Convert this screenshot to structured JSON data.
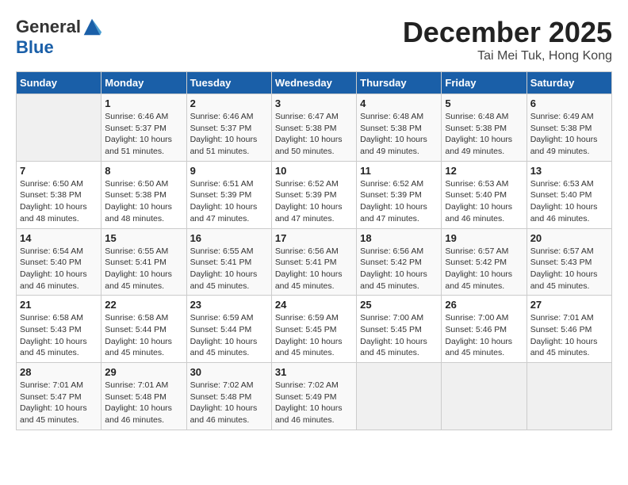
{
  "header": {
    "logo_line1": "General",
    "logo_line2": "Blue",
    "month_title": "December 2025",
    "location": "Tai Mei Tuk, Hong Kong"
  },
  "weekdays": [
    "Sunday",
    "Monday",
    "Tuesday",
    "Wednesday",
    "Thursday",
    "Friday",
    "Saturday"
  ],
  "weeks": [
    [
      {
        "day": "",
        "info": ""
      },
      {
        "day": "1",
        "info": "Sunrise: 6:46 AM\nSunset: 5:37 PM\nDaylight: 10 hours\nand 51 minutes."
      },
      {
        "day": "2",
        "info": "Sunrise: 6:46 AM\nSunset: 5:37 PM\nDaylight: 10 hours\nand 51 minutes."
      },
      {
        "day": "3",
        "info": "Sunrise: 6:47 AM\nSunset: 5:38 PM\nDaylight: 10 hours\nand 50 minutes."
      },
      {
        "day": "4",
        "info": "Sunrise: 6:48 AM\nSunset: 5:38 PM\nDaylight: 10 hours\nand 49 minutes."
      },
      {
        "day": "5",
        "info": "Sunrise: 6:48 AM\nSunset: 5:38 PM\nDaylight: 10 hours\nand 49 minutes."
      },
      {
        "day": "6",
        "info": "Sunrise: 6:49 AM\nSunset: 5:38 PM\nDaylight: 10 hours\nand 49 minutes."
      }
    ],
    [
      {
        "day": "7",
        "info": "Sunrise: 6:50 AM\nSunset: 5:38 PM\nDaylight: 10 hours\nand 48 minutes."
      },
      {
        "day": "8",
        "info": "Sunrise: 6:50 AM\nSunset: 5:38 PM\nDaylight: 10 hours\nand 48 minutes."
      },
      {
        "day": "9",
        "info": "Sunrise: 6:51 AM\nSunset: 5:39 PM\nDaylight: 10 hours\nand 47 minutes."
      },
      {
        "day": "10",
        "info": "Sunrise: 6:52 AM\nSunset: 5:39 PM\nDaylight: 10 hours\nand 47 minutes."
      },
      {
        "day": "11",
        "info": "Sunrise: 6:52 AM\nSunset: 5:39 PM\nDaylight: 10 hours\nand 47 minutes."
      },
      {
        "day": "12",
        "info": "Sunrise: 6:53 AM\nSunset: 5:40 PM\nDaylight: 10 hours\nand 46 minutes."
      },
      {
        "day": "13",
        "info": "Sunrise: 6:53 AM\nSunset: 5:40 PM\nDaylight: 10 hours\nand 46 minutes."
      }
    ],
    [
      {
        "day": "14",
        "info": "Sunrise: 6:54 AM\nSunset: 5:40 PM\nDaylight: 10 hours\nand 46 minutes."
      },
      {
        "day": "15",
        "info": "Sunrise: 6:55 AM\nSunset: 5:41 PM\nDaylight: 10 hours\nand 45 minutes."
      },
      {
        "day": "16",
        "info": "Sunrise: 6:55 AM\nSunset: 5:41 PM\nDaylight: 10 hours\nand 45 minutes."
      },
      {
        "day": "17",
        "info": "Sunrise: 6:56 AM\nSunset: 5:41 PM\nDaylight: 10 hours\nand 45 minutes."
      },
      {
        "day": "18",
        "info": "Sunrise: 6:56 AM\nSunset: 5:42 PM\nDaylight: 10 hours\nand 45 minutes."
      },
      {
        "day": "19",
        "info": "Sunrise: 6:57 AM\nSunset: 5:42 PM\nDaylight: 10 hours\nand 45 minutes."
      },
      {
        "day": "20",
        "info": "Sunrise: 6:57 AM\nSunset: 5:43 PM\nDaylight: 10 hours\nand 45 minutes."
      }
    ],
    [
      {
        "day": "21",
        "info": "Sunrise: 6:58 AM\nSunset: 5:43 PM\nDaylight: 10 hours\nand 45 minutes."
      },
      {
        "day": "22",
        "info": "Sunrise: 6:58 AM\nSunset: 5:44 PM\nDaylight: 10 hours\nand 45 minutes."
      },
      {
        "day": "23",
        "info": "Sunrise: 6:59 AM\nSunset: 5:44 PM\nDaylight: 10 hours\nand 45 minutes."
      },
      {
        "day": "24",
        "info": "Sunrise: 6:59 AM\nSunset: 5:45 PM\nDaylight: 10 hours\nand 45 minutes."
      },
      {
        "day": "25",
        "info": "Sunrise: 7:00 AM\nSunset: 5:45 PM\nDaylight: 10 hours\nand 45 minutes."
      },
      {
        "day": "26",
        "info": "Sunrise: 7:00 AM\nSunset: 5:46 PM\nDaylight: 10 hours\nand 45 minutes."
      },
      {
        "day": "27",
        "info": "Sunrise: 7:01 AM\nSunset: 5:46 PM\nDaylight: 10 hours\nand 45 minutes."
      }
    ],
    [
      {
        "day": "28",
        "info": "Sunrise: 7:01 AM\nSunset: 5:47 PM\nDaylight: 10 hours\nand 45 minutes."
      },
      {
        "day": "29",
        "info": "Sunrise: 7:01 AM\nSunset: 5:48 PM\nDaylight: 10 hours\nand 46 minutes."
      },
      {
        "day": "30",
        "info": "Sunrise: 7:02 AM\nSunset: 5:48 PM\nDaylight: 10 hours\nand 46 minutes."
      },
      {
        "day": "31",
        "info": "Sunrise: 7:02 AM\nSunset: 5:49 PM\nDaylight: 10 hours\nand 46 minutes."
      },
      {
        "day": "",
        "info": ""
      },
      {
        "day": "",
        "info": ""
      },
      {
        "day": "",
        "info": ""
      }
    ]
  ]
}
